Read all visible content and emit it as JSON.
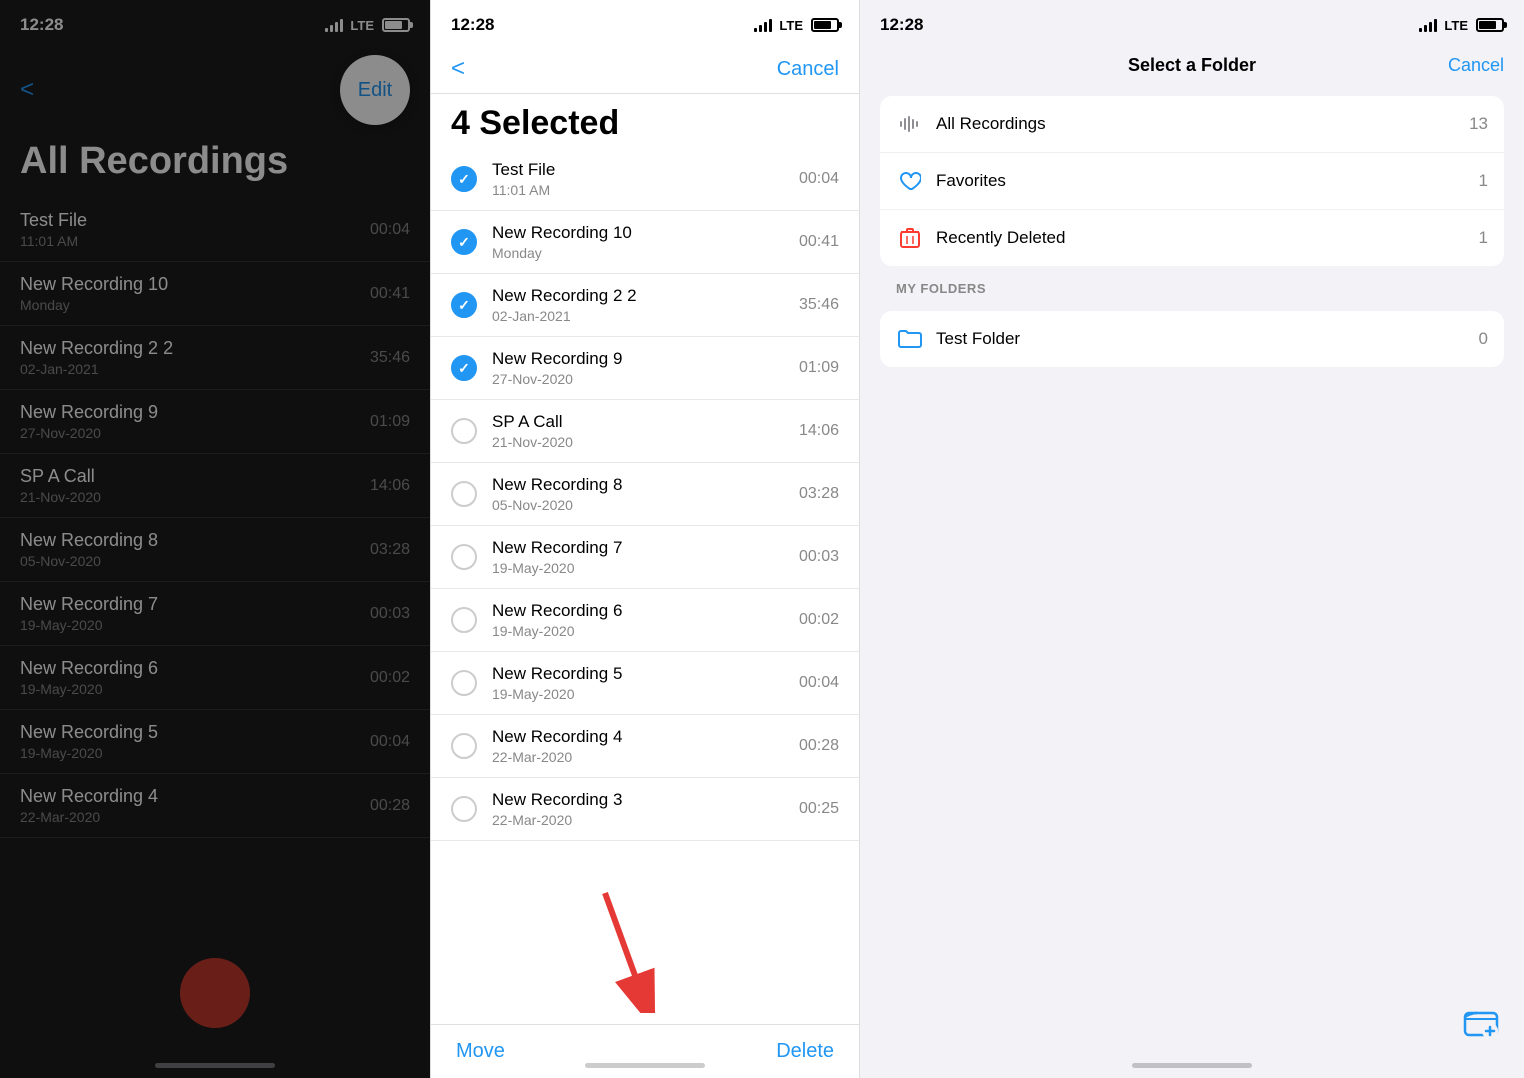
{
  "panel1": {
    "status": {
      "time": "12:28",
      "location": "◀",
      "signal": "LTE",
      "battery": 70
    },
    "nav": {
      "back_label": "<",
      "edit_label": "Edit"
    },
    "title": "All Recordings",
    "recordings": [
      {
        "name": "Test File",
        "date": "11:01 AM",
        "duration": "00:04"
      },
      {
        "name": "New Recording 10",
        "date": "Monday",
        "duration": "00:41"
      },
      {
        "name": "New Recording 2 2",
        "date": "02-Jan-2021",
        "duration": "35:46"
      },
      {
        "name": "New Recording 9",
        "date": "27-Nov-2020",
        "duration": "01:09"
      },
      {
        "name": "SP A Call",
        "date": "21-Nov-2020",
        "duration": "14:06"
      },
      {
        "name": "New Recording 8",
        "date": "05-Nov-2020",
        "duration": "03:28"
      },
      {
        "name": "New Recording 7",
        "date": "19-May-2020",
        "duration": "00:03"
      },
      {
        "name": "New Recording 6",
        "date": "19-May-2020",
        "duration": "00:02"
      },
      {
        "name": "New Recording 5",
        "date": "19-May-2020",
        "duration": "00:04"
      },
      {
        "name": "New Recording 4",
        "date": "22-Mar-2020",
        "duration": "00:28"
      }
    ]
  },
  "panel2": {
    "status": {
      "time": "12:28",
      "signal": "LTE"
    },
    "nav": {
      "back_label": "<",
      "cancel_label": "Cancel"
    },
    "title": "4 Selected",
    "recordings": [
      {
        "name": "Test File",
        "date": "11:01 AM",
        "duration": "00:04",
        "checked": true
      },
      {
        "name": "New Recording 10",
        "date": "Monday",
        "duration": "00:41",
        "checked": true
      },
      {
        "name": "New Recording 2 2",
        "date": "02-Jan-2021",
        "duration": "35:46",
        "checked": true
      },
      {
        "name": "New Recording 9",
        "date": "27-Nov-2020",
        "duration": "01:09",
        "checked": true
      },
      {
        "name": "SP A Call",
        "date": "21-Nov-2020",
        "duration": "14:06",
        "checked": false
      },
      {
        "name": "New Recording 8",
        "date": "05-Nov-2020",
        "duration": "03:28",
        "checked": false
      },
      {
        "name": "New Recording 7",
        "date": "19-May-2020",
        "duration": "00:03",
        "checked": false
      },
      {
        "name": "New Recording 6",
        "date": "19-May-2020",
        "duration": "00:02",
        "checked": false
      },
      {
        "name": "New Recording 5",
        "date": "19-May-2020",
        "duration": "00:04",
        "checked": false
      },
      {
        "name": "New Recording 4",
        "date": "22-Mar-2020",
        "duration": "00:28",
        "checked": false
      },
      {
        "name": "New Recording 3",
        "date": "22-Mar-2020",
        "duration": "00:25",
        "checked": false
      }
    ],
    "bottom": {
      "move_label": "Move",
      "delete_label": "Delete"
    }
  },
  "panel3": {
    "status": {
      "time": "12:28",
      "signal": "LTE"
    },
    "nav": {
      "title": "Select a Folder",
      "cancel_label": "Cancel"
    },
    "system_folders": [
      {
        "name": "All Recordings",
        "count": "13",
        "icon": "waveform"
      },
      {
        "name": "Favorites",
        "count": "1",
        "icon": "heart"
      },
      {
        "name": "Recently Deleted",
        "count": "1",
        "icon": "trash"
      }
    ],
    "my_folders_header": "MY FOLDERS",
    "my_folders": [
      {
        "name": "Test Folder",
        "count": "0",
        "icon": "folder"
      }
    ]
  }
}
